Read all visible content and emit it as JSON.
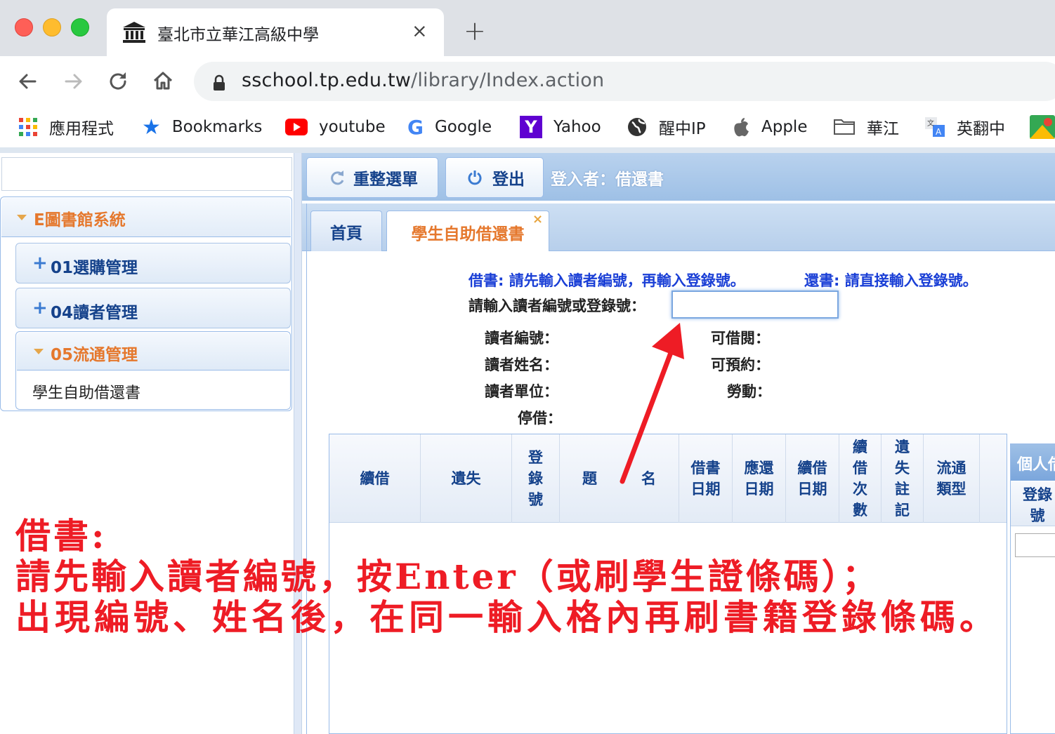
{
  "browser": {
    "tab_title": "臺北市立華江高級中學",
    "tab_close": "×",
    "new_tab": "+",
    "url_host": "sschool.tp.edu.tw",
    "url_path": "/library/Index.action",
    "bookmarks": [
      {
        "label": "應用程式",
        "icon": "apps-grid-icon"
      },
      {
        "label": "Bookmarks",
        "icon": "star-icon",
        "color": "#1a73e8"
      },
      {
        "label": "youtube",
        "icon": "youtube-icon",
        "color": "#ff0000"
      },
      {
        "label": "Google",
        "icon": "google-icon"
      },
      {
        "label": "Yahoo",
        "icon": "yahoo-icon",
        "color": "#5f01d1"
      },
      {
        "label": "醒中IP",
        "icon": "globe-icon"
      },
      {
        "label": "Apple",
        "icon": "apple-icon"
      },
      {
        "label": "華江",
        "icon": "folder-icon"
      },
      {
        "label": "英翻中",
        "icon": "translate-icon"
      }
    ]
  },
  "sidebar": {
    "root": "E圖書館系統",
    "items": [
      {
        "label": "01選購管理",
        "expanded": false
      },
      {
        "label": "04讀者管理",
        "expanded": false
      },
      {
        "label": "05流通管理",
        "expanded": true
      }
    ],
    "leaf": "學生自助借還書"
  },
  "topbar": {
    "refresh_label": "重整選單",
    "logout_label": "登出",
    "login_info": "登入者：借還書"
  },
  "tabs": {
    "home": "首頁",
    "active": "學生自助借還書",
    "close": "×"
  },
  "form": {
    "instr_borrow": "借書: 請先輸入讀者編號，再輸入登錄號。",
    "instr_return": "還書: 請直接輸入登錄號。",
    "input_label": "請輸入讀者編號或登錄號：",
    "input_value": "",
    "reader_id_label": "讀者編號：",
    "reader_name_label": "讀者姓名：",
    "reader_unit_label": "讀者單位：",
    "suspend_label": "停借：",
    "can_borrow_label": "可借閱：",
    "can_reserve_label": "可預約：",
    "labor_label": "勞動："
  },
  "table": {
    "columns": [
      "續借",
      "遺失",
      "登\n錄\n號",
      "題　　　名",
      "借書\n日期",
      "應還\n日期",
      "續借\n日期",
      "續\n借\n次\n數",
      "遺\n失\n註\n記",
      "流通\n類型",
      ""
    ]
  },
  "side_panel": {
    "title": "個人借",
    "col": "登錄\n號"
  },
  "annotation": {
    "line1": "借書:",
    "line2": "請先輸入讀者編號，按Enter（或刷學生證條碼）；",
    "line3": "出現編號、姓名後，在同一輸入格內再刷書籍登錄條碼。",
    "color": "#ee1c25"
  }
}
